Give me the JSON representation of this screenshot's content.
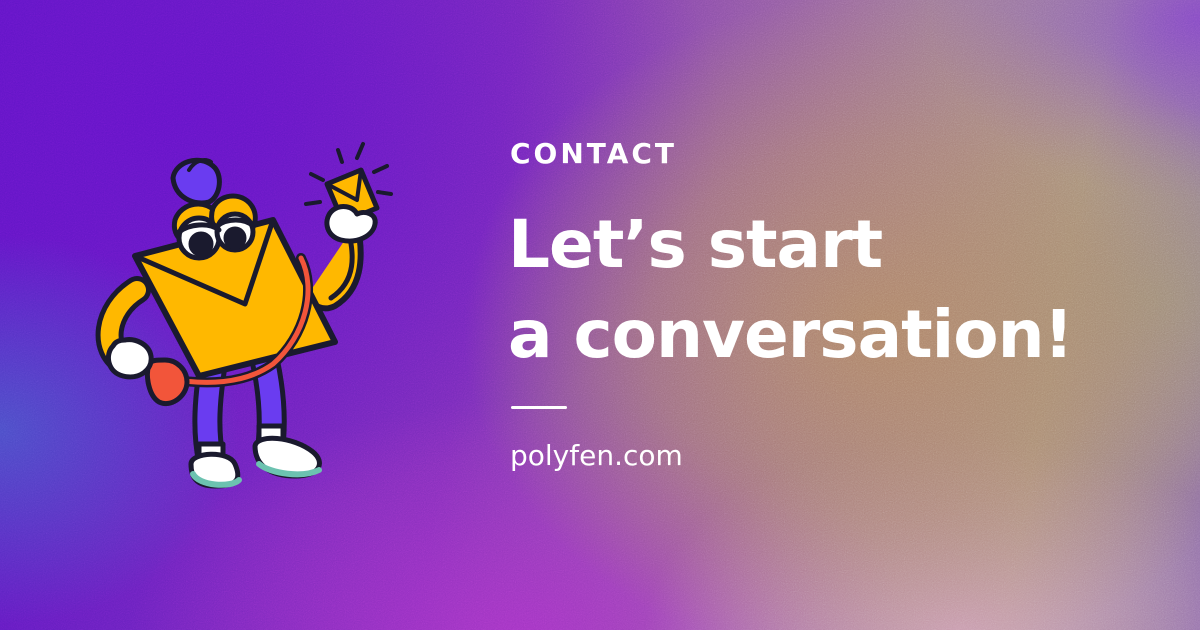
{
  "page": {
    "eyebrow": "CONTACT",
    "headline_line1": "Let’s start",
    "headline_line2": "a conversation!",
    "url": "polyfen.com"
  },
  "mascot": {
    "icon": "envelope-mascot-icon",
    "held_item_icon": "envelope-icon"
  },
  "colors": {
    "text": "#ffffff",
    "mascot_body": "#ffb800",
    "mascot_legs": "#6a3cf0",
    "mascot_bag": "#f2553a",
    "outline": "#1a1a2e",
    "shoe_sole": "#6cc2b0"
  }
}
